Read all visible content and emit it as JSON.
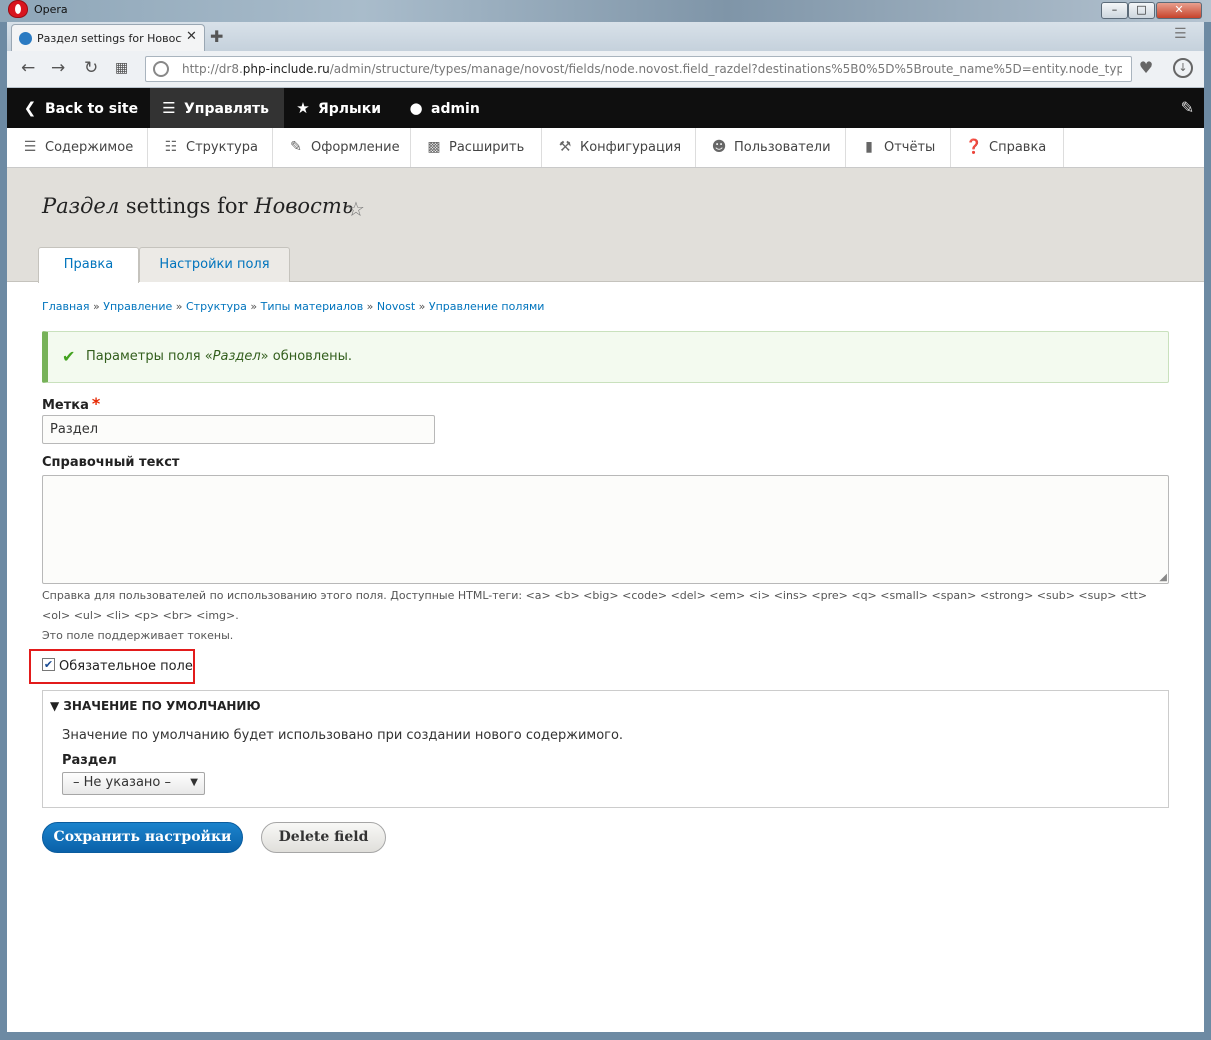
{
  "window": {
    "app_name": "Opera",
    "tab_title": "Раздел settings for Новость",
    "url_prefix": "http://dr8.",
    "url_host": "php-include.ru",
    "url_path": "/admin/structure/types/manage/novost/fields/node.novost.field_razdel?destinations%5B0%5D%5Broute_name%5D=entity.node_type.field_ui_fields&de"
  },
  "toolbar": {
    "back": "Back to site",
    "manage": "Управлять",
    "shortcuts": "Ярлыки",
    "user": "admin"
  },
  "tray": [
    {
      "label": "Содержимое",
      "icon": "content-icon"
    },
    {
      "label": "Структура",
      "icon": "structure-icon"
    },
    {
      "label": "Оформление",
      "icon": "appearance-icon"
    },
    {
      "label": "Расширить",
      "icon": "extend-icon"
    },
    {
      "label": "Конфигурация",
      "icon": "config-icon"
    },
    {
      "label": "Пользователи",
      "icon": "people-icon"
    },
    {
      "label": "Отчёты",
      "icon": "reports-icon"
    },
    {
      "label": "Справка",
      "icon": "help-icon"
    }
  ],
  "page": {
    "title_em1": "Раздел",
    "title_mid": " settings for ",
    "title_em2": "Новость",
    "tabs": [
      "Правка",
      "Настройки поля"
    ]
  },
  "breadcrumb": [
    "Главная",
    "Управление",
    "Структура",
    "Типы материалов",
    "Novost",
    "Управление полями"
  ],
  "message": {
    "before": "Параметры поля «",
    "field": "Раздел",
    "after": "» обновлены."
  },
  "form": {
    "label_field": "Метка",
    "label_value": "Раздел",
    "help_label": "Справочный текст",
    "help_desc_1": "Справка для пользователей по использованию этого поля. Доступные HTML-теги: <a> <b> <big> <code> <del> <em> <i> <ins> <pre> <q> <small> <span> <strong> <sub> <sup> <tt>",
    "help_desc_2": "<ol> <ul> <li> <p> <br> <img>.",
    "help_desc_3": "Это поле поддерживает токены.",
    "required_label": "Обязательное поле",
    "required_checked": true,
    "default_legend": "ЗНАЧЕНИЕ ПО УМОЛЧАНИЮ",
    "default_desc": "Значение по умолчанию будет использовано при создании нового содержимого.",
    "default_field_label": "Раздел",
    "default_select_value": "– Не указано –",
    "save_button": "Сохранить настройки",
    "delete_button": "Delete field"
  }
}
